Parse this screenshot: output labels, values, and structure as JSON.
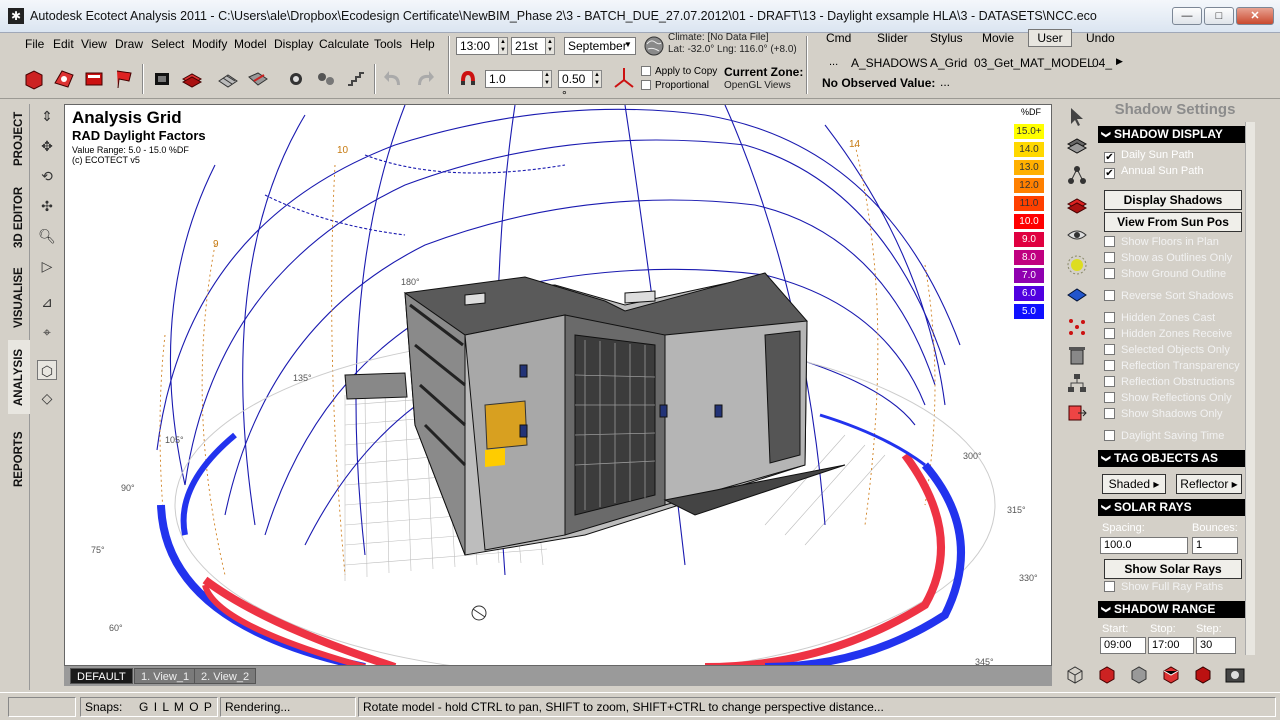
{
  "window": {
    "title": "Autodesk Ecotect Analysis 2011 - C:\\Users\\ale\\Dropbox\\Ecodesign Certificate\\NewBIM_Phase 2\\3 - BATCH_DUE_27.07.2012\\01 - DRAFT\\13 - Daylight exsample HLA\\3 - DATASETS\\NCC.eco",
    "minimize": "—",
    "maximize": "□",
    "close": "✕"
  },
  "menu": [
    "File",
    "Edit",
    "View",
    "Draw",
    "Select",
    "Modify",
    "Model",
    "Display",
    "Calculate",
    "Tools",
    "Help"
  ],
  "date_time": {
    "time": "13:00",
    "day": "21st",
    "month": "September"
  },
  "climate": {
    "file": "Climate: [No Data File]",
    "coords": "Lat: -32.0°  Lng: 116.0° (+8.0)"
  },
  "tool_values": {
    "value1": "1.0",
    "value2": "0.50 °"
  },
  "copy_options": {
    "apply_copy": "Apply to Copy",
    "proportional": "Proportional"
  },
  "current_zone": {
    "label": "Current Zone:",
    "sub": "OpenGL Views"
  },
  "cmd_tabs": [
    "Cmd",
    "Slider",
    "Stylus",
    "Movie",
    "User",
    "Undo"
  ],
  "active_cmd_tab": "User",
  "zones": [
    "...",
    "A_SHADOWS",
    "A_Grid",
    "03_Get_MAT_MODEL",
    "04_"
  ],
  "observed": {
    "label": "No Observed Value:",
    "value": "..."
  },
  "side_tabs": [
    "PROJECT",
    "3D EDITOR",
    "VISUALISE",
    "ANALYSIS",
    "REPORTS"
  ],
  "viewport": {
    "title": "Analysis Grid",
    "subtitle": "RAD Daylight Factors",
    "range": "Value Range: 5.0 - 15.0 %DF",
    "copyright": "(c) ECOTECT v5",
    "legend_unit": "%DF",
    "legend": [
      {
        "label": "15.0+",
        "color": "#ffff00"
      },
      {
        "label": "14.0",
        "color": "#ffd800"
      },
      {
        "label": "13.0",
        "color": "#ffb000"
      },
      {
        "label": "12.0",
        "color": "#ff8000"
      },
      {
        "label": "11.0",
        "color": "#ff4000"
      },
      {
        "label": "10.0",
        "color": "#ff0000"
      },
      {
        "label": "9.0",
        "color": "#e00040"
      },
      {
        "label": "8.0",
        "color": "#c00080"
      },
      {
        "label": "7.0",
        "color": "#9000b0"
      },
      {
        "label": "6.0",
        "color": "#5000e0"
      },
      {
        "label": "5.0",
        "color": "#1010ff"
      }
    ],
    "hour_labels": [
      "10",
      "14",
      "9"
    ],
    "angle_labels": [
      "135°",
      "90°",
      "75°",
      "60°",
      "300°",
      "315°",
      "330°",
      "345°",
      "180°",
      "105°"
    ],
    "tabs": [
      "DEFAULT",
      "1. View_1",
      "2. View_2"
    ]
  },
  "status": {
    "snaps_label": "Snaps:",
    "snaps": "G I L M O P",
    "state": "Rendering...",
    "message": "Rotate model - hold CTRL to pan, SHIFT to zoom, SHIFT+CTRL to change perspective distance..."
  },
  "panel": {
    "title": "Shadow Settings",
    "sections": {
      "shadow_display": "SHADOW DISPLAY",
      "tag_objects": "TAG OBJECTS AS",
      "solar_rays": "SOLAR RAYS",
      "shadow_range": "SHADOW RANGE"
    },
    "checks_top": [
      {
        "label": "Daily Sun Path",
        "checked": true
      },
      {
        "label": "Annual Sun Path",
        "checked": true
      }
    ],
    "display_shadows": "Display Shadows",
    "view_from_sun": "View From Sun Pos",
    "checks_mid": [
      "Show Floors in Plan",
      "Show as Outlines Only",
      "Show Ground Outline"
    ],
    "reverse_sort": "Reverse Sort Shadows",
    "checks_low": [
      "Hidden Zones Cast",
      "Hidden Zones Receive",
      "Selected Objects Only",
      "Reflection Transparency",
      "Reflection Obstructions",
      "Show Reflections Only",
      "Show Shadows Only"
    ],
    "daylight_saving": "Daylight Saving Time",
    "tag_shaded": "Shaded",
    "tag_reflector": "Reflector",
    "spacing_label": "Spacing:",
    "bounces_label": "Bounces:",
    "spacing_value": "100.0",
    "bounces_value": "1",
    "show_solar_rays": "Show Solar Rays",
    "show_full_ray": "Show Full Ray Paths",
    "range_labels": [
      "Start:",
      "Stop:",
      "Step:"
    ],
    "range_values": [
      "09:00",
      "17:00",
      "30"
    ]
  }
}
